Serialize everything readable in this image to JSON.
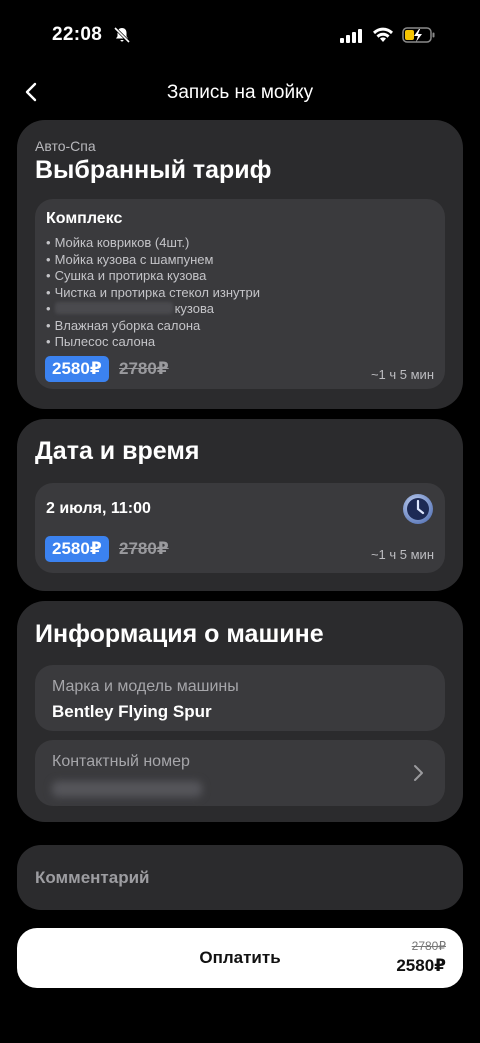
{
  "status_bar": {
    "time": "22:08"
  },
  "nav": {
    "title": "Запись на мойку"
  },
  "tariff_card": {
    "brand": "Авто-Спа",
    "heading": "Выбранный тариф",
    "name": "Комплекс",
    "services": [
      "Мойка ковриков (4шт.)",
      "Мойка кузова с шампунем",
      "Сушка и протирка кузова",
      "Чистка и протирка стекол изнутри",
      "кузова",
      "Влажная уборка салона",
      "Пылесос салона"
    ],
    "price_new": "2580₽",
    "price_old": "2780₽",
    "duration": "~1 ч 5 мин"
  },
  "datetime_card": {
    "heading": "Дата и время",
    "value": "2 июля, 11:00",
    "price_new": "2580₽",
    "price_old": "2780₽",
    "duration": "~1 ч 5 мин"
  },
  "car_card": {
    "heading": "Информация о машине",
    "model_label": "Марка и модель машины",
    "model_value": "Bentley Flying Spur",
    "phone_label": "Контактный номер"
  },
  "comment": {
    "placeholder": "Комментарий"
  },
  "pay": {
    "label": "Оплатить",
    "price_old": "2780₽",
    "price_new": "2580₽"
  },
  "colors": {
    "accent": "#3b82f0",
    "card": "#2b2b2d",
    "inner": "#3a3a3d"
  }
}
